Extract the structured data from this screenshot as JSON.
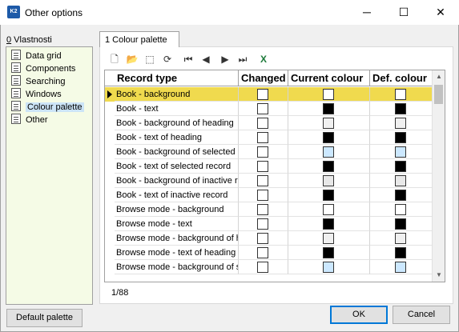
{
  "window": {
    "title": "Other options",
    "app_icon_text": "K2",
    "minimize_glyph": "─",
    "maximize_glyph": "☐",
    "close_glyph": "✕"
  },
  "left": {
    "label_underline": "0",
    "label_rest": " Vlastnosti",
    "items": [
      {
        "label": "Data grid",
        "icon": "list-icon"
      },
      {
        "label": "Components",
        "icon": "list-icon"
      },
      {
        "label": "Searching",
        "icon": "list-icon"
      },
      {
        "label": "Windows",
        "icon": "list-icon"
      },
      {
        "label": "Colour palette",
        "icon": "list-icon",
        "selected": true
      },
      {
        "label": "Other",
        "icon": "list-icon"
      }
    ]
  },
  "tab": {
    "label": "1 Colour palette"
  },
  "toolbar": [
    {
      "name": "new-icon",
      "glyph": "🗋"
    },
    {
      "name": "open-icon",
      "glyph": "📂"
    },
    {
      "name": "cube-icon",
      "glyph": "⬚"
    },
    {
      "name": "refresh-icon",
      "glyph": "⟳"
    },
    {
      "name": "first-icon",
      "glyph": "⏮"
    },
    {
      "name": "prev-icon",
      "glyph": "◀"
    },
    {
      "name": "next-icon",
      "glyph": "▶"
    },
    {
      "name": "last-icon",
      "glyph": "⏭"
    },
    {
      "name": "excel-icon",
      "glyph": "X"
    }
  ],
  "grid": {
    "columns": [
      "Record type",
      "Changed",
      "Current colour",
      "Def. colour"
    ],
    "rows": [
      {
        "type": "Book - background",
        "current": "#ffffff",
        "def": "#ffffff"
      },
      {
        "type": "Book - text",
        "current": "#000000",
        "def": "#000000"
      },
      {
        "type": "Book - background of heading",
        "current": "#f0f0f0",
        "def": "#f0f0f0"
      },
      {
        "type": "Book - text of heading",
        "current": "#000000",
        "def": "#000000"
      },
      {
        "type": "Book - background of selected r",
        "current": "#cce8ff",
        "def": "#cce8ff"
      },
      {
        "type": "Book - text of selected record",
        "current": "#000000",
        "def": "#000000"
      },
      {
        "type": "Book - background of inactive re",
        "current": "#e8e8e8",
        "def": "#e8e8e8"
      },
      {
        "type": "Book - text of inactive record",
        "current": "#000000",
        "def": "#000000"
      },
      {
        "type": "Browse mode - background",
        "current": "#ffffff",
        "def": "#ffffff"
      },
      {
        "type": "Browse mode - text",
        "current": "#000000",
        "def": "#000000"
      },
      {
        "type": "Browse mode - background of h",
        "current": "#f0f0f0",
        "def": "#f0f0f0"
      },
      {
        "type": "Browse mode - text of heading",
        "current": "#000000",
        "def": "#000000"
      },
      {
        "type": "Browse mode - background of s",
        "current": "#cce8ff",
        "def": "#cce8ff"
      }
    ]
  },
  "status": {
    "position": "1/88"
  },
  "buttons": {
    "default_palette": "Default palette",
    "ok": "OK",
    "cancel": "Cancel"
  },
  "colors": {
    "selected_row": "#f0da4e",
    "left_panel_bg": "#f5fbe6"
  }
}
